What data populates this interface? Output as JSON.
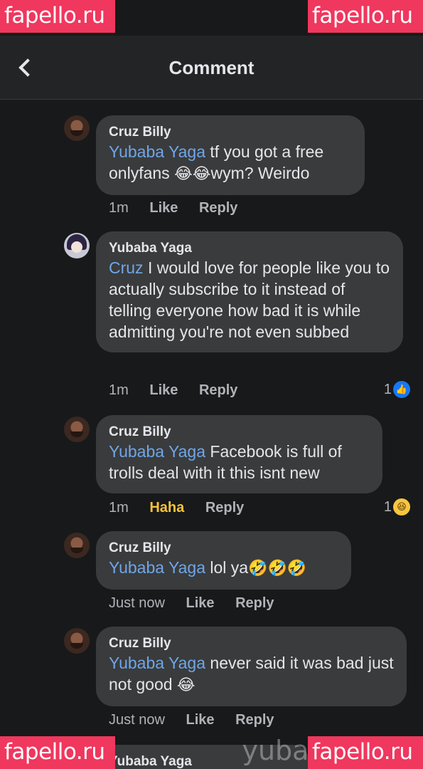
{
  "watermark": {
    "site": "fapello.ru",
    "subject": "yubal"
  },
  "header": {
    "title": "Comment",
    "back_icon": "chevron-left-icon"
  },
  "comments": [
    {
      "author": "Cruz Billy",
      "mention": "Yubaba Yaga",
      "text_1": " tf you got a free onlyfans ",
      "emoji_1": "😂😂",
      "text_2": "wym? Weirdo",
      "time": "1m",
      "like_label": "Like",
      "reply_label": "Reply"
    },
    {
      "author": "Yubaba Yaga",
      "mention": "Cruz",
      "text_1": " I would love for people like you to actually subscribe to it instead of telling everyone how bad it is while admitting you're not even subbed",
      "time": "1m",
      "like_label": "Like",
      "reply_label": "Reply",
      "reaction_count": "1",
      "reaction_icon": "👍"
    },
    {
      "author": "Cruz Billy",
      "mention": "Yubaba Yaga",
      "text_1": " Facebook is full of trolls deal with it this isnt new",
      "time": "1m",
      "like_label": "Haha",
      "reply_label": "Reply",
      "reaction_count": "1",
      "reaction_icon": "😆"
    },
    {
      "author": "Cruz Billy",
      "mention": "Yubaba Yaga",
      "text_1": " lol ya",
      "emoji_1": "🤣🤣🤣",
      "time": "Just now",
      "like_label": "Like",
      "reply_label": "Reply"
    },
    {
      "author": "Cruz Billy",
      "mention": "Yubaba Yaga",
      "text_1": " never said it was bad just not good ",
      "emoji_1": "😂",
      "time": "Just now",
      "like_label": "Like",
      "reply_label": "Reply"
    },
    {
      "author": "Yubaba Yaga"
    }
  ],
  "colors": {
    "background": "#18191a",
    "bubble": "#3a3b3c",
    "mention": "#6fa6e8",
    "haha": "#f5c33b",
    "like": "#1877f2",
    "watermark": "#f0375e"
  }
}
